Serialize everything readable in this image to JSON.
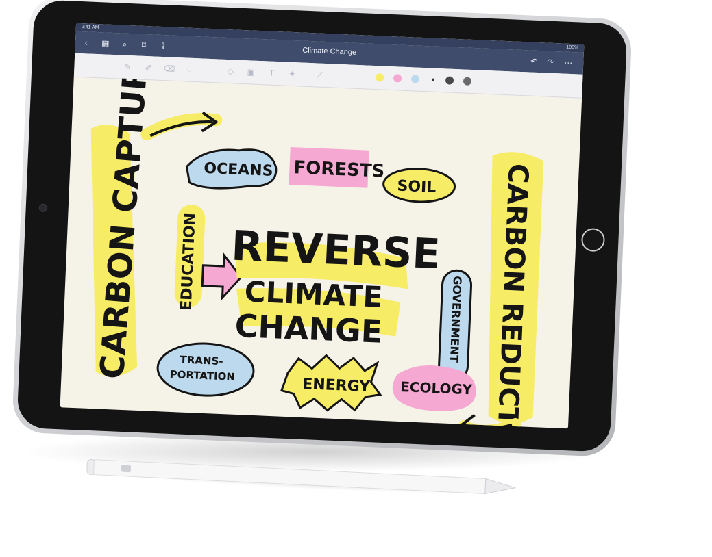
{
  "device": {
    "status_bar": {
      "time": "9:41 AM",
      "battery": "100%"
    },
    "nav_bar": {
      "title": "Climate Change"
    },
    "colors": {
      "yellow": "#f7ec66",
      "pink": "#f5a8d2",
      "blue": "#bcd9ee",
      "ink": "#151515",
      "nav": "#3f4c6b"
    },
    "palette": [
      "#f7ec66",
      "#f5a8d2",
      "#bcd9ee",
      "#222222",
      "#4a4a4a",
      "#6a6a6a"
    ]
  },
  "sketch": {
    "headline_1": "REVERSE",
    "headline_2": "CLIMATE",
    "headline_3": "CHANGE",
    "left_vertical": "CARBON CAPTURE",
    "right_vertical": "CARBON REDUCTION",
    "oceans": "OCEANS",
    "forests": "FORESTS",
    "soil": "SOIL",
    "education": "EDUCATION",
    "government": "GOVERNMENT",
    "transportation_1": "TRANS-",
    "transportation_2": "PORTATION",
    "energy": "ENERGY",
    "ecology": "ECOLOGY"
  }
}
